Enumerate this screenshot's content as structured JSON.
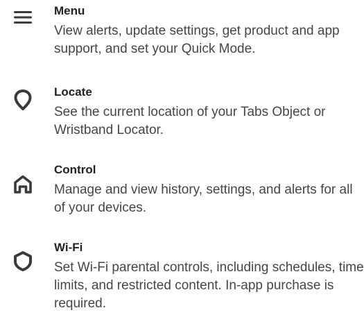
{
  "items": [
    {
      "icon": "hamburger-menu-icon",
      "title": "Menu",
      "description": "View alerts, update settings, get product and app support, and set your Quick Mode."
    },
    {
      "icon": "location-pin-icon",
      "title": "Locate",
      "description": "See the current location of your Tabs Object or Wristband Locator."
    },
    {
      "icon": "home-icon",
      "title": "Control",
      "description": "Manage and view history, settings, and alerts for all of your devices."
    },
    {
      "icon": "shield-icon",
      "title": "Wi-Fi",
      "description": "Set Wi-Fi parental controls, including schedules, time limits, and restricted content. In-app purchase is required."
    }
  ],
  "colors": {
    "icon": "#3a3a3a",
    "title": "#222222",
    "description": "#454545",
    "background": "#ffffff"
  }
}
